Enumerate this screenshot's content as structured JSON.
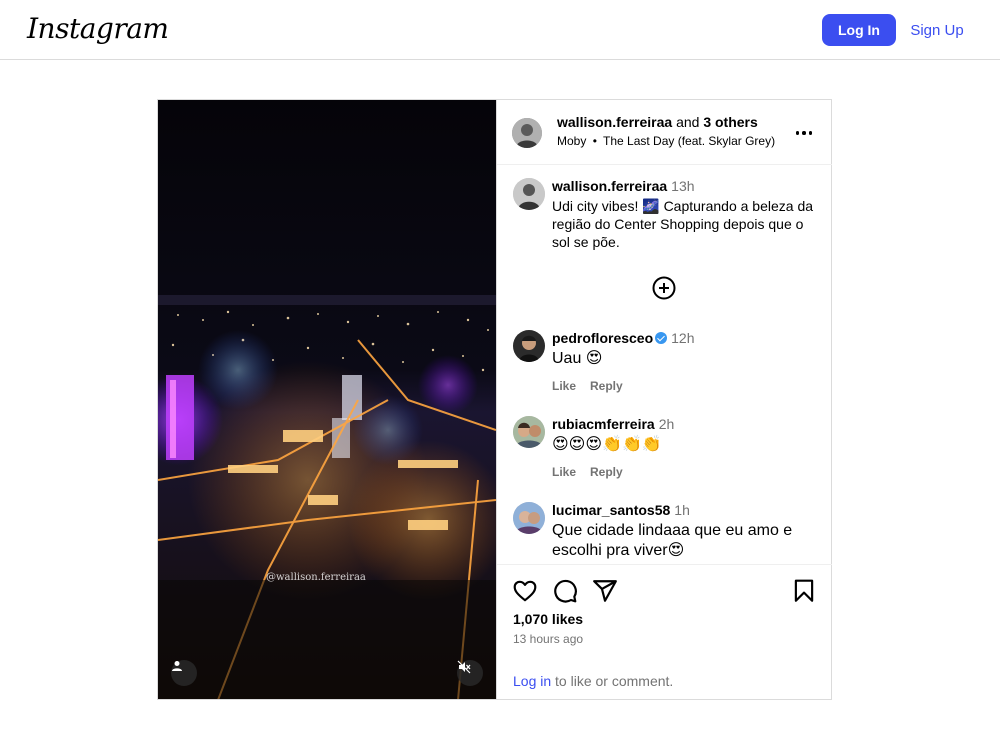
{
  "topbar": {
    "logo": "Instagram",
    "login_label": "Log In",
    "signup_label": "Sign Up"
  },
  "media": {
    "watermark": "@wallison.ferreiraa",
    "user_icon": "person-icon",
    "mute_icon": "muted-speaker-icon"
  },
  "header": {
    "author": "wallison.ferreiraa",
    "and_text": "and",
    "others": "3 others",
    "music_artist": "Moby",
    "separator": "•",
    "music_track": "The Last Day (feat. Skylar Grey)"
  },
  "caption": {
    "username": "wallison.ferreiraa",
    "time": "13h",
    "text": "Udi city vibes! 🌌 Capturando a beleza da região do Center Shopping depois que o sol se põe."
  },
  "comments": [
    {
      "username": "pedrofloresceo",
      "verified": true,
      "time": "12h",
      "text": "Uau 😍",
      "like": "Like",
      "reply": "Reply"
    },
    {
      "username": "rubiacmferreira",
      "verified": false,
      "time": "2h",
      "text": "😍😍😍👏👏👏",
      "like": "Like",
      "reply": "Reply"
    },
    {
      "username": "lucimar_santos58",
      "verified": false,
      "time": "1h",
      "text": "Que cidade lindaaa que eu amo e escolhi pra viver😍"
    }
  ],
  "footer": {
    "likes": "1,070 likes",
    "ago": "13 hours ago",
    "login_link": "Log in",
    "login_rest": " to like or comment."
  },
  "colors": {
    "accent": "#3b4ef0",
    "muted_text": "#737373",
    "border": "#dbdbdb",
    "verified": "#3897f0"
  }
}
